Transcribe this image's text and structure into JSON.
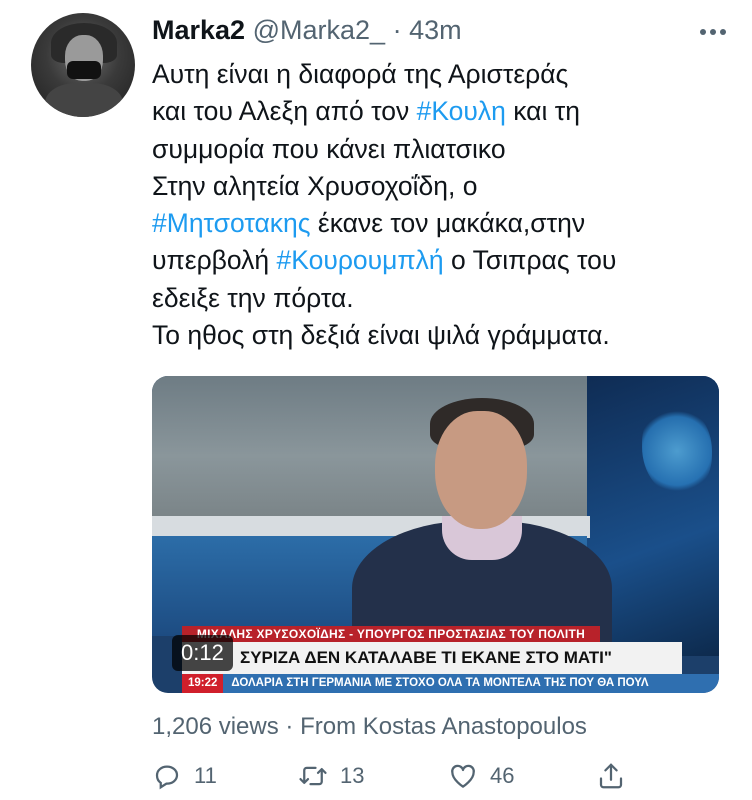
{
  "tweet": {
    "author_name": "Marka2",
    "handle": "@Marka2_",
    "separator": "·",
    "time": "43m",
    "text_lines": [
      [
        "Αυτη είναι η διαφορά της Αριστεράς"
      ],
      [
        "και του Αλεξη από τον ",
        "#Κουλη",
        " και τη"
      ],
      [
        "συμμορία που κάνει πλιατσικο"
      ],
      [
        "Στην αλητεία Χρυσοχοΐδη, ο"
      ],
      [
        "",
        "#Μητσοτακης",
        " έκανε τον μακάκα,στην"
      ],
      [
        "υπερβολή ",
        "#Κουρουμπλή",
        " ο Τσιπρας του"
      ],
      [
        "εδειξε την πόρτα."
      ],
      [
        "Το ηθος στη δεξιά είναι ψιλά γράμματα."
      ]
    ],
    "hashtag_color": "#1d9bf0"
  },
  "video": {
    "duration": "0:12",
    "lower_third_name": "ΜΙΧΑΛΗΣ ΧΡΥΣΟΧΟΪΔΗΣ - ΥΠΟΥΡΓΟΣ ΠΡΟΣΤΑΣΙΑΣ ΤΟΥ ΠΟΛΙΤΗ",
    "headline": "ΣΥΡΙΖΑ ΔΕΝ ΚΑΤΑΛΑΒΕ ΤΙ ΕΚΑΝΕ ΣΤΟ ΜΑΤΙ\"",
    "ticker_time": "19:22",
    "ticker_text": "ΔΟΛΑΡΙΑ ΣΤΗ ΓΕΡΜΑΝΙΑ ΜΕ ΣΤΟΧΟ ΟΛΑ ΤΑ ΜΟΝΤΕΛΑ ΤΗΣ ΠΟΥ ΘΑ ΠΟΥΛ"
  },
  "stats": {
    "views": "1,206 views",
    "separator": "·",
    "from": "From Kostas Anastopoulos"
  },
  "actions": {
    "replies": "11",
    "retweets": "13",
    "likes": "46",
    "icons": [
      "reply-icon",
      "retweet-icon",
      "like-icon",
      "share-icon"
    ]
  }
}
